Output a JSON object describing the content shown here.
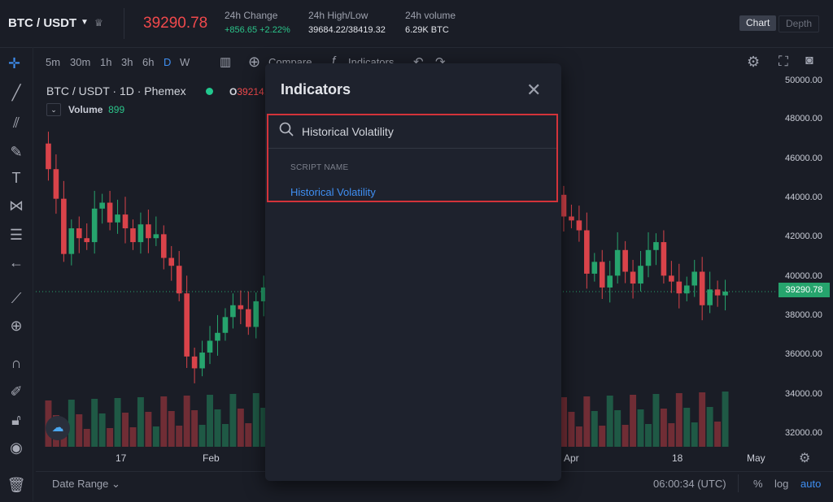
{
  "header": {
    "pair": "BTC / USDT",
    "last_price": "39290.78",
    "change_label": "24h Change",
    "change_value": "+856.65 +2.22%",
    "highlow_label": "24h High/Low",
    "highlow_value": "39684.22/38419.32",
    "volume_label": "24h volume",
    "volume_value": "6.29K BTC",
    "views": [
      "Chart",
      "Depth"
    ]
  },
  "toolbar": {
    "timeframes": [
      "5m",
      "30m",
      "1h",
      "3h",
      "6h",
      "D",
      "W"
    ],
    "active_timeframe": "D",
    "compare_label": "Compare",
    "indicators_label": "Indicators"
  },
  "chart": {
    "legend_title": "BTC / USDT · 1D · Phemex",
    "open_label": "O",
    "open_value": "39214.",
    "volume_label": "Volume",
    "volume_value": "899",
    "price_tag": "39290.78",
    "y_labels": [
      "50000.00",
      "48000.00",
      "46000.00",
      "44000.00",
      "42000.00",
      "40000.00",
      "38000.00",
      "36000.00",
      "34000.00",
      "32000.00"
    ],
    "x_labels": [
      "17",
      "Feb",
      "Apr",
      "18",
      "May"
    ]
  },
  "bottom": {
    "date_range": "Date Range",
    "clock": "06:00:34 (UTC)",
    "pct": "%",
    "log": "log",
    "auto": "auto"
  },
  "modal": {
    "title": "Indicators",
    "search_value": "Historical Volatility",
    "section_header": "SCRIPT NAME",
    "results": [
      "Historical Volatility"
    ]
  },
  "colors": {
    "up": "#26a46d",
    "down": "#d9434a",
    "accent": "#3f8ff2",
    "highlight": "#d3333a"
  }
}
